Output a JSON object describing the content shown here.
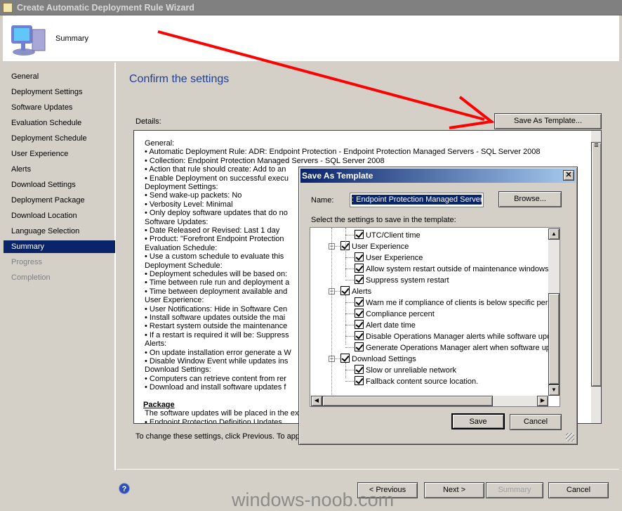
{
  "window": {
    "title": "Create Automatic Deployment Rule Wizard",
    "header_step": "Summary"
  },
  "nav": {
    "items": [
      {
        "label": "General",
        "state": "normal"
      },
      {
        "label": "Deployment Settings",
        "state": "normal"
      },
      {
        "label": "Software Updates",
        "state": "normal"
      },
      {
        "label": "Evaluation Schedule",
        "state": "normal"
      },
      {
        "label": "Deployment Schedule",
        "state": "normal"
      },
      {
        "label": "User Experience",
        "state": "normal"
      },
      {
        "label": "Alerts",
        "state": "normal"
      },
      {
        "label": "Download Settings",
        "state": "normal"
      },
      {
        "label": "Deployment Package",
        "state": "normal"
      },
      {
        "label": "Download Location",
        "state": "normal"
      },
      {
        "label": "Language Selection",
        "state": "normal"
      },
      {
        "label": "Summary",
        "state": "selected"
      },
      {
        "label": "Progress",
        "state": "disabled"
      },
      {
        "label": "Completion",
        "state": "disabled"
      }
    ]
  },
  "main": {
    "heading": "Confirm the settings",
    "details_label": "Details:",
    "save_template_label": "Save As Template...",
    "footer_text": "To change these settings, click Previous. To app",
    "details": [
      {
        "t": "General:",
        "k": "h"
      },
      {
        "t": "Automatic Deployment Rule: ADR: Endpoint Protection - Endpoint Protection Managed Servers - SQL Server 2008",
        "k": "b"
      },
      {
        "t": "Collection: Endpoint Protection Managed Servers - SQL Server 2008",
        "k": "b"
      },
      {
        "t": "Action that rule should create: Add to an",
        "k": "b"
      },
      {
        "t": "Enable Deployment on successful execu",
        "k": "b"
      },
      {
        "t": "Deployment Settings:",
        "k": "h"
      },
      {
        "t": "Send wake-up packets: No",
        "k": "b"
      },
      {
        "t": "Verbosity Level: Minimal",
        "k": "b"
      },
      {
        "t": "Only deploy software updates that do no",
        "k": "b"
      },
      {
        "t": "Software Updates:",
        "k": "h"
      },
      {
        "t": "Date Released or Revised: Last 1 day",
        "k": "b"
      },
      {
        "t": "Product: \"Forefront Endpoint Protection",
        "k": "b"
      },
      {
        "t": "Evaluation Schedule:",
        "k": "h"
      },
      {
        "t": "Use a custom schedule to evaluate this",
        "k": "b"
      },
      {
        "t": "Deployment Schedule:",
        "k": "h"
      },
      {
        "t": "Deployment schedules will be based on:",
        "k": "b"
      },
      {
        "t": "Time between rule run and deployment a",
        "k": "b"
      },
      {
        "t": "Time between deployment available and",
        "k": "b"
      },
      {
        "t": "User Experience:",
        "k": "h"
      },
      {
        "t": "User Notifications: Hide in Software Cen",
        "k": "b"
      },
      {
        "t": "Install software updates outside the mai",
        "k": "b"
      },
      {
        "t": "Restart system outside the maintenance",
        "k": "b"
      },
      {
        "t": "If a restart is required it will be: Suppress",
        "k": "b"
      },
      {
        "t": "Alerts:",
        "k": "h"
      },
      {
        "t": "On update installation error generate a W",
        "k": "b"
      },
      {
        "t": "Disable Window Event while updates ins",
        "k": "b"
      },
      {
        "t": "Download Settings:",
        "k": "h"
      },
      {
        "t": "Computers can retrieve content from rer",
        "k": "b"
      },
      {
        "t": "Download and install software updates f",
        "k": "b"
      },
      {
        "t": "",
        "k": "h"
      },
      {
        "t": "Package",
        "k": "p"
      },
      {
        "t": "The software updates will be placed in the ex",
        "k": "h"
      },
      {
        "t": "Endpoint Protection Definition Updates",
        "k": "b"
      }
    ]
  },
  "buttons": {
    "previous": "< Previous",
    "next": "Next >",
    "summary": "Summary",
    "cancel": "Cancel"
  },
  "watermark": "windows-noob.com",
  "dialog": {
    "title": "Save As Template",
    "name_label": "Name:",
    "name_value": ": Endpoint Protection Managed Servers",
    "browse": "Browse...",
    "select_label": "Select the settings to save in the template:",
    "save": "Save",
    "cancel": "Cancel",
    "tree": [
      {
        "label": "UTC/Client time",
        "level": 2,
        "checked": true
      },
      {
        "label": "User Experience",
        "level": 1,
        "checked": true,
        "expanded": true
      },
      {
        "label": "User Experience",
        "level": 2,
        "checked": true
      },
      {
        "label": "Allow system restart outside of maintenance windows",
        "level": 2,
        "checked": true
      },
      {
        "label": "Suppress system restart",
        "level": 2,
        "checked": true
      },
      {
        "label": "Alerts",
        "level": 1,
        "checked": true,
        "expanded": true
      },
      {
        "label": "Warn me if compliance of clients is below specific percentage",
        "level": 2,
        "checked": true
      },
      {
        "label": "Compliance percent",
        "level": 2,
        "checked": true
      },
      {
        "label": "Alert date time",
        "level": 2,
        "checked": true
      },
      {
        "label": "Disable Operations Manager alerts while software updates install",
        "level": 2,
        "checked": true
      },
      {
        "label": "Generate Operations Manager alert when software update installation fails",
        "level": 2,
        "checked": true
      },
      {
        "label": "Download Settings",
        "level": 1,
        "checked": true,
        "expanded": true
      },
      {
        "label": "Slow or unreliable network",
        "level": 2,
        "checked": true
      },
      {
        "label": "Fallback content source location.",
        "level": 2,
        "checked": true
      }
    ]
  },
  "colors": {
    "selection": "#0a246a",
    "heading": "#1f3f8f",
    "annotation_arrow": "#ff0000"
  }
}
